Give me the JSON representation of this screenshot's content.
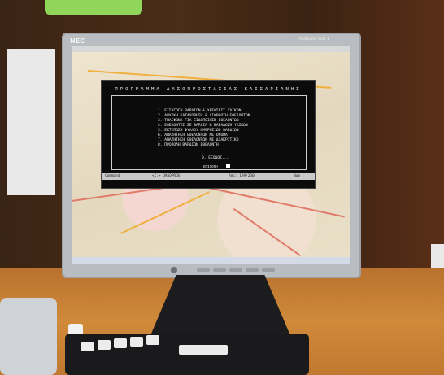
{
  "monitor": {
    "brand": "NEC",
    "model": "MultiSync LCD 1"
  },
  "console": {
    "title": "ΠΡΟΓΡΑΜΜΑ ΔΑΣΟΠΡΟΣΤΑΣΙΑΣ ΚΑΙΣΑΡΙΑΝΗΣ",
    "menu_items": [
      "1. ΕΙΣΑΓΩΓΗ ΒΑΡΔΙΩΝ & ΧΡΕΩΣΕΙΣ ΥΛΙΚΩΝ",
      "2. ΑΡΧΙΚΗ ΚΑΤΑΧΩΡΗΣΗ & ΔΙΟΡΘΩΣΗ ΕΘΕΛΟΝΤΩΝ",
      "3. ΤΗΛΕΦΩΝΑ ΓΙΑ ΕΙΔΟΠΟΙΗΣΗ ΕΘΕΛΟΝΤΩΝ",
      "4. ΕΘΕΛΟΝΤΕΣ ΣΕ ΒΑΡΔΙΑ & ΠΑΡΑΔΟΣΗ ΥΛΙΚΩΝ",
      "5. ΕΚΤΥΠΩΣΗ ΦΥΛΛΟΥ ΗΜΕΡΗΣΙΩΝ ΒΑΡΔΙΩΝ",
      "6. ΑΝΑΖΗΤΗΣΗ ΕΘΕΛΟΝΤΩΝ ΜΕ ΟΝΟΜΑ",
      "7. ΑΝΑΖΗΤΗΣΗ ΕΘΕΛΟΝΤΩΝ ΜΕ ΔΙΑΚΡΙΤΙΚΟ",
      "8. ΠΡΟΒΟΛΗ ΒΑΡΔΙΩΝ ΕΘΕΛΟΝΤΗ"
    ],
    "exit_label": "0. ΕΞΟΔΟΣ...",
    "choice_label": "ΕΠΙΛΟΓΗ",
    "status": {
      "mode": "Command",
      "db": "<C:> DASOPROS",
      "rec": "Rec: 199/230",
      "num": "Num"
    }
  },
  "colors": {
    "console_bg": "#0b0b0b",
    "console_text": "#f0f0f0",
    "status_bg": "#c9c9c9"
  }
}
